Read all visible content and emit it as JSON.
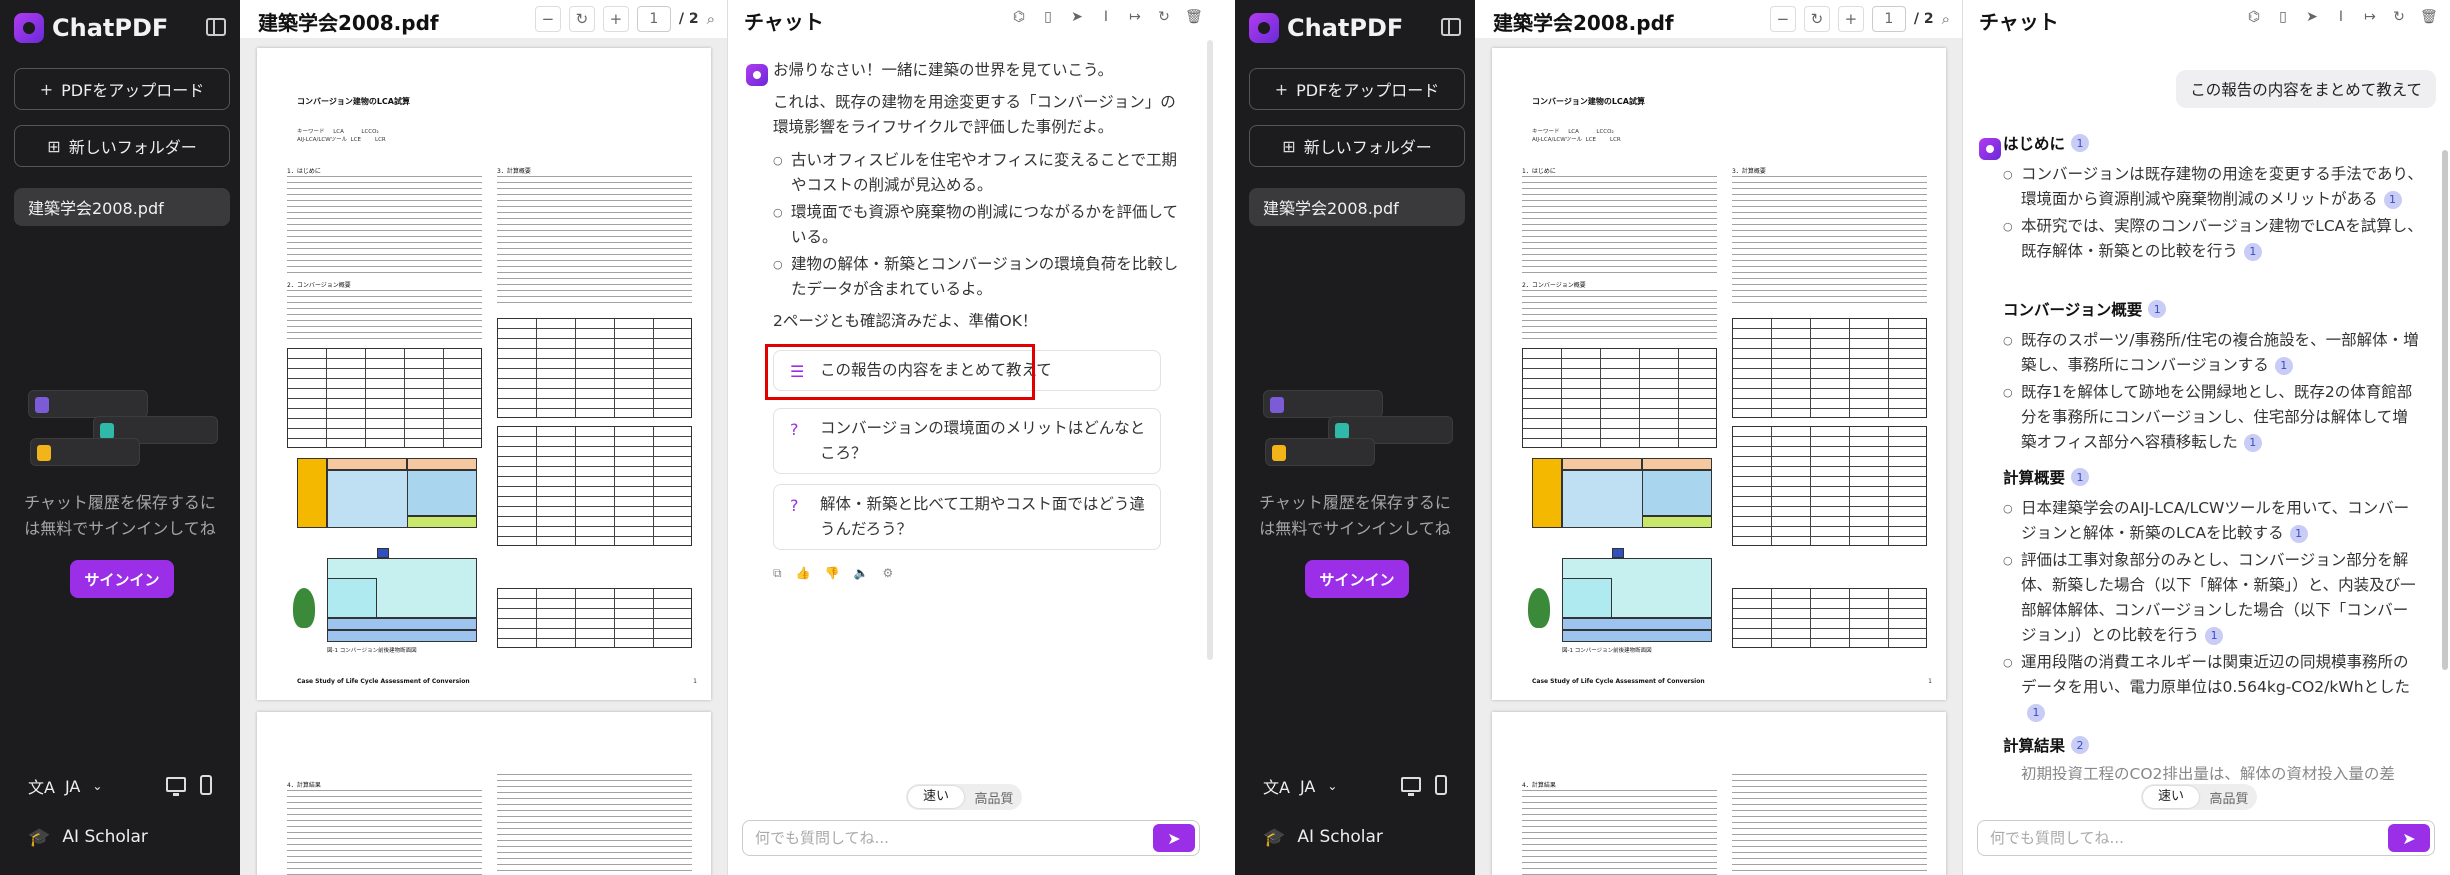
{
  "app": {
    "logo": "ChatPDF",
    "upload_label": "PDFをアップロード",
    "new_folder_label": "新しいフォルダー",
    "doc_item": "建築学会2008.pdf",
    "history_text": "チャット履歴を保存するには無料でサインインしてね",
    "signin_label": "サインイン",
    "lang_label": "JA",
    "scholar_label": "AI Scholar"
  },
  "pdf": {
    "title": "建築学会2008.pdf",
    "page_current": "1",
    "page_total": "/ 2",
    "page_heading": "コンバージョン建物のLCA試算",
    "meta_lines": "キーワード     LCA          LCCO₂\nAIJ-LCA/LCWツール  LCE        LCR",
    "section1": "1．はじめに",
    "section2": "2．コンバージョン概要",
    "section3": "3．計算概要",
    "section4": "4．計算結果",
    "footer": "Case Study of Life Cycle Assessment of Conversion",
    "page_no": "1",
    "fig_caption": "図-1 コンバージョン前後建物断面図"
  },
  "chat": {
    "title": "チャット",
    "welcome": "お帰りなさい！一緒に建築の世界を見ていこう。",
    "intro": "これは、既存の建物を用途変更する「コンバージョン」の環境影響をライフサイクルで評価した事例だよ。",
    "bullets": [
      "古いオフィスビルを住宅やオフィスに変えることで工期やコストの削減が見込める。",
      "環境面でも資源や廃棄物の削減につながるかを評価している。",
      "建物の解体・新築とコンバージョンの環境負荷を比較したデータが含まれているよ。"
    ],
    "ready": "2ページとも確認済みだよ、準備OK！",
    "suggestions": [
      "この報告の内容をまとめて教えて",
      "コンバージョンの環境面のメリットはどんなところ？",
      "解体・新築と比べて工期やコスト面ではどう違うんだろう？"
    ],
    "mode_fast": "速い",
    "mode_quality": "高品質",
    "input_placeholder": "何でも質問してね..."
  },
  "answer": {
    "user_question": "この報告の内容をまとめて教えて",
    "sections": [
      {
        "heading": "はじめに",
        "cite": "1",
        "items": [
          "コンバージョンは既存建物の用途を変更する手法であり、環境面から資源削減や廃棄物削減のメリットがある",
          "本研究では、実際のコンバージョン建物でLCAを試算し、既存解体・新築との比較を行う"
        ],
        "item_cites": [
          "1",
          "1"
        ]
      },
      {
        "heading": "コンバージョン概要",
        "cite": "1",
        "items": [
          "既存のスポーツ/事務所/住宅の複合施設を、一部解体・増築し、事務所にコンバージョンする",
          "既存1を解体して跡地を公開緑地とし、既存2の体育館部分を事務所にコンバージョンし、住宅部分は解体して増築オフィス部分へ容積移転した"
        ],
        "item_cites": [
          "1",
          "1"
        ]
      },
      {
        "heading": "計算概要",
        "cite": "1",
        "items": [
          "日本建築学会のAIJ-LCA/LCWツールを用いて、コンバージョンと解体・新築のLCAを比較する",
          "評価は工事対象部分のみとし、コンバージョン部分を解体、新築した場合（以下「解体・新築」）と、内装及び一部解体解体、コンバージョンした場合（以下「コンバージョン」）との比較を行う",
          "運用段階の消費エネルギーは関東近辺の同規模事務所のデータを用い、電力原単位は0.564kg-CO2/kWhとした"
        ],
        "item_cites": [
          "1",
          "1",
          "1"
        ]
      },
      {
        "heading": "計算結果",
        "cite": "2",
        "items": [],
        "item_cites": []
      }
    ],
    "cut_text": "初期投資工程のCO2排出量は、解体の資材投入量の差"
  },
  "colors": {
    "accent": "#9b2fe8",
    "sidebar_bg": "#1c1c1e",
    "highlight_box": "#e00000",
    "cite_bg": "#c9cdf5"
  }
}
